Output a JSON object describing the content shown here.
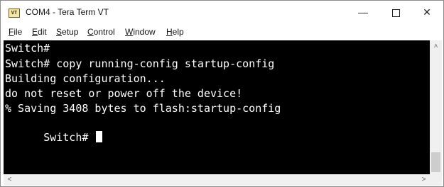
{
  "window": {
    "title": "COM4 - Tera Term VT",
    "icon_text": "VT",
    "controls": {
      "minimize": "—",
      "close": "✕"
    }
  },
  "menu": {
    "items": [
      {
        "label": "File",
        "accel": "F"
      },
      {
        "label": "Edit",
        "accel": "E"
      },
      {
        "label": "Setup",
        "accel": "S"
      },
      {
        "label": "Control",
        "accel": "C"
      },
      {
        "label": "Window",
        "accel": "W"
      },
      {
        "label": "Help",
        "accel": "H"
      }
    ]
  },
  "terminal": {
    "lines": [
      "Switch#",
      "Switch# copy running-config startup-config",
      "Building configuration...",
      "do not reset or power off the device!",
      "% Saving 3408 bytes to flash:startup-config",
      "Switch# "
    ],
    "background": "#000000",
    "foreground": "#ffffff"
  },
  "scrollbars": {
    "up_arrow": "˄",
    "left_arrow": "<",
    "right_arrow": ">"
  }
}
